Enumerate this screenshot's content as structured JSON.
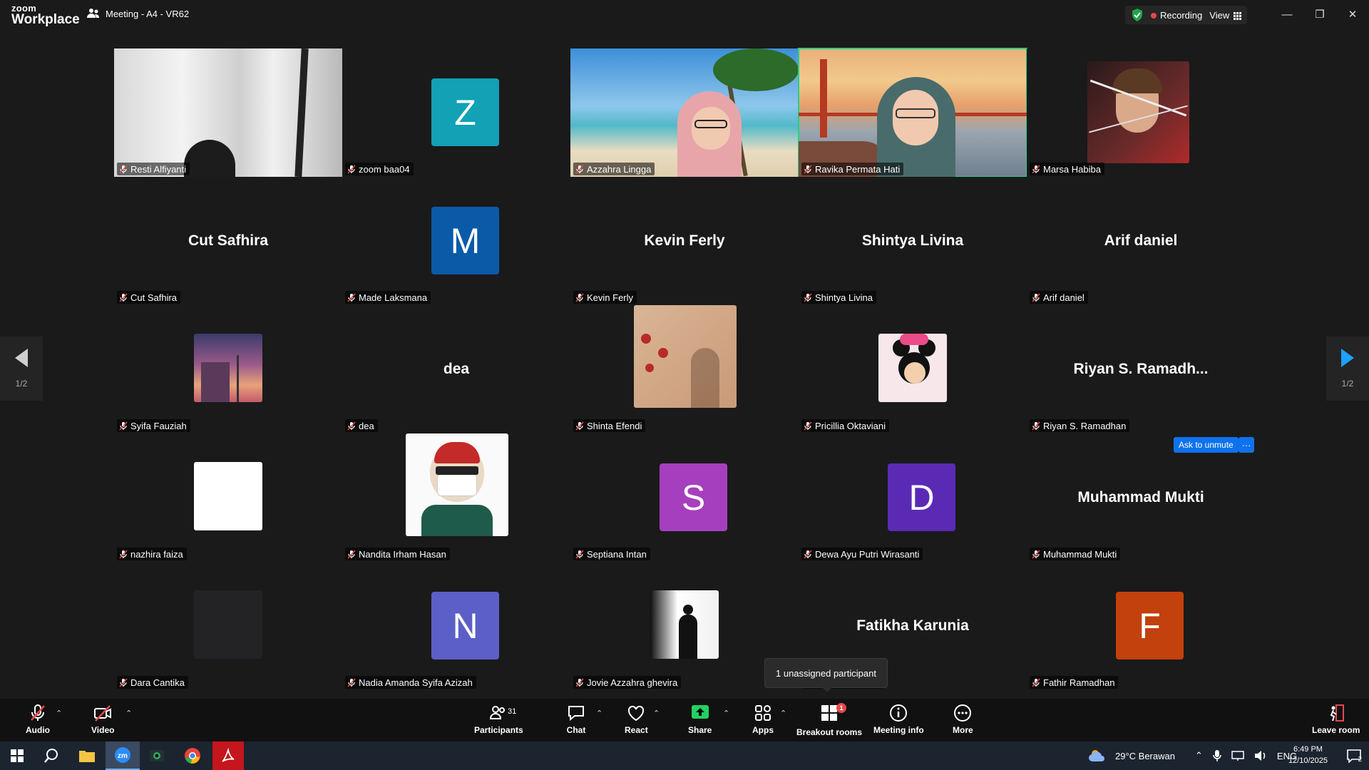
{
  "app": {
    "logo_top": "zoom",
    "logo_bottom": "Workplace",
    "meeting_title": "Meeting - A4 - VR62"
  },
  "status": {
    "recording_label": "Recording",
    "view_label": "View"
  },
  "pager": {
    "left": "1/2",
    "right": "1/2"
  },
  "participants": [
    {
      "name": "Resti Alfiyanti",
      "kind": "video"
    },
    {
      "name": "zoom baa04",
      "kind": "letter",
      "letter": "Z",
      "color": "#13a1b6"
    },
    {
      "name": "Azzahra Lingga",
      "kind": "video"
    },
    {
      "name": "Ravika Permata Hati",
      "kind": "video"
    },
    {
      "name": "Marsa Habiba",
      "kind": "photo"
    },
    {
      "name": "Cut Safhira",
      "kind": "text",
      "display": "Cut Safhira"
    },
    {
      "name": "Made Laksmana",
      "kind": "letter",
      "letter": "M",
      "color": "#0b5aa8"
    },
    {
      "name": "Kevin Ferly",
      "kind": "text",
      "display": "Kevin Ferly"
    },
    {
      "name": "Shintya Livina",
      "kind": "text",
      "display": "Shintya Livina"
    },
    {
      "name": "Arif daniel",
      "kind": "text",
      "display": "Arif daniel"
    },
    {
      "name": "Syifa Fauziah",
      "kind": "photo"
    },
    {
      "name": "dea",
      "kind": "text",
      "display": "dea"
    },
    {
      "name": "Shinta Efendi",
      "kind": "photo"
    },
    {
      "name": "Pricillia Oktaviani",
      "kind": "photo"
    },
    {
      "name": "Riyan S. Ramadhan",
      "kind": "text",
      "display": "Riyan S. Ramadh..."
    },
    {
      "name": "nazhira faiza",
      "kind": "photo"
    },
    {
      "name": "Nandita Irham Hasan",
      "kind": "photo"
    },
    {
      "name": "Septiana Intan",
      "kind": "letter",
      "letter": "S",
      "color": "#a63fbd"
    },
    {
      "name": "Dewa Ayu Putri Wirasanti",
      "kind": "letter",
      "letter": "D",
      "color": "#5a2ab5"
    },
    {
      "name": "Muhammad Mukti",
      "kind": "text",
      "display": "Muhammad Mukti"
    },
    {
      "name": "Dara Cantika",
      "kind": "photo"
    },
    {
      "name": "Nadia Amanda Syifa Azizah",
      "kind": "letter",
      "letter": "N",
      "color": "#5b5fc7"
    },
    {
      "name": "Jovie Azzahra ghevira",
      "kind": "photo"
    },
    {
      "name": "Fatikha Karunia",
      "kind": "text",
      "display": "Fatikha Karunia"
    },
    {
      "name": "Fathir Ramadhan",
      "kind": "letter",
      "letter": "F",
      "color": "#c2410c"
    }
  ],
  "actions": {
    "ask_unmute": "Ask to unmute",
    "more": "···"
  },
  "tooltip": "1 unassigned participant",
  "toolbar": {
    "audio": "Audio",
    "video": "Video",
    "participants": "Participants",
    "participants_count": "31",
    "chat": "Chat",
    "react": "React",
    "share": "Share",
    "apps": "Apps",
    "breakout": "Breakout rooms",
    "breakout_badge": "1",
    "info": "Meeting info",
    "more": "More",
    "leave": "Leave room"
  },
  "taskbar": {
    "weather": "29°C  Berawan",
    "lang": "ENG",
    "time": "6:49 PM",
    "date": "12/10/2025",
    "notif": "2"
  },
  "colors": {
    "accent": "#0e72ed",
    "active_speaker": "#23d18b",
    "record": "#e5484d"
  }
}
